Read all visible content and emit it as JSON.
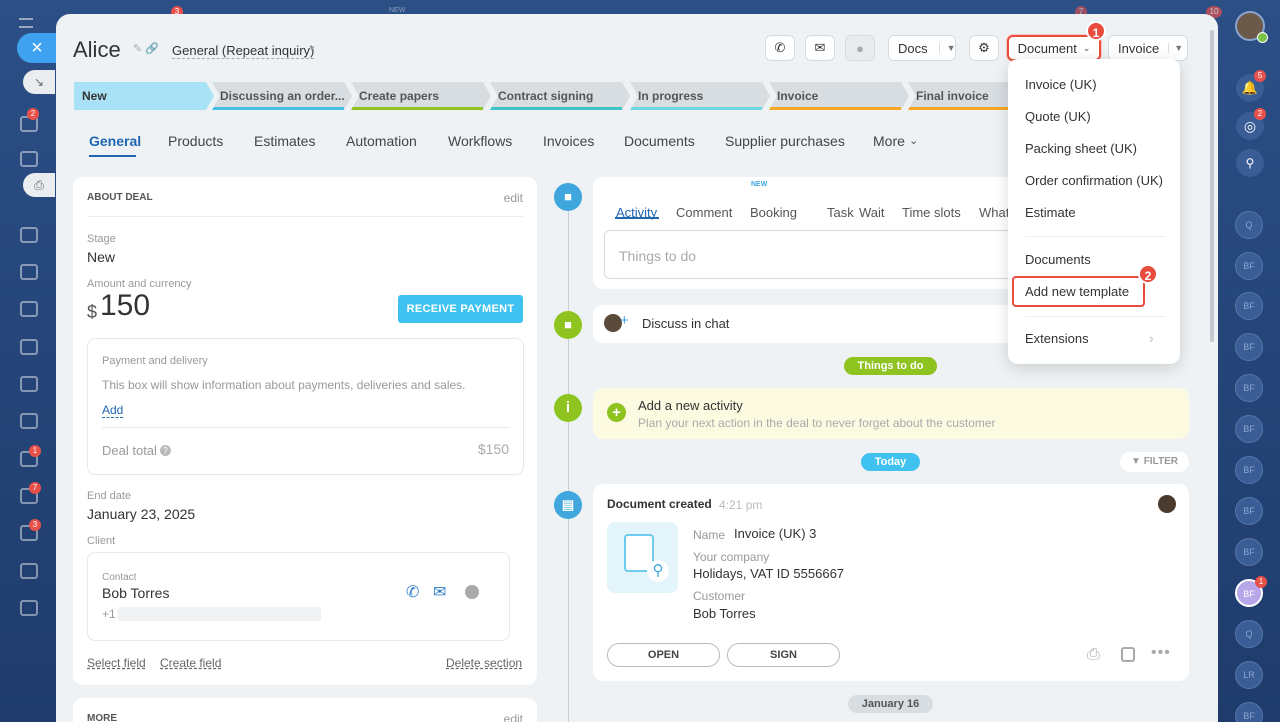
{
  "deal": {
    "title": "Alice",
    "category": "General (Repeat inquiry)"
  },
  "header": {
    "docs_label": "Docs",
    "document_label": "Document",
    "invoice_label": "Invoice",
    "marker_1": "1",
    "marker_2": "2"
  },
  "stages": [
    "New",
    "Discussing an order...",
    "Create papers",
    "Contract signing",
    "In progress",
    "Invoice",
    "Final invoice"
  ],
  "tabs": [
    "General",
    "Products",
    "Estimates",
    "Automation",
    "Workflows",
    "Invoices",
    "Documents",
    "Supplier purchases",
    "More"
  ],
  "about": {
    "heading": "ABOUT DEAL",
    "edit": "edit",
    "stage_label": "Stage",
    "stage_value": "New",
    "amount_label": "Amount and currency",
    "currency": "$",
    "amount": "150",
    "receive_payment": "RECEIVE PAYMENT",
    "payment_title": "Payment and delivery",
    "payment_text": "This box will show information about payments, deliveries and sales.",
    "add": "Add",
    "deal_total_label": "Deal total",
    "deal_total_value": "$150",
    "end_date_label": "End date",
    "end_date_value": "January 23, 2025",
    "client_label": "Client",
    "contact_label": "Contact",
    "contact_name": "Bob Torres",
    "contact_phone": "+1",
    "select_field": "Select field",
    "create_field": "Create field",
    "delete_section": "Delete section"
  },
  "more_section": {
    "heading": "MORE",
    "edit": "edit"
  },
  "activity": {
    "tabs": [
      "Activity",
      "Comment",
      "Booking",
      "Task",
      "Wait",
      "Time slots",
      "What"
    ],
    "booking_badge": "NEW",
    "placeholder": "Things to do",
    "discuss": "Discuss in chat",
    "things_to_do_pill": "Things to do",
    "add_title": "Add a new activity",
    "add_sub": "Plan your next action in the deal to never forget about the customer",
    "today_pill": "Today",
    "filter": "FILTER",
    "date_pill": "January 16"
  },
  "document_event": {
    "title": "Document created",
    "time": "4:21 pm",
    "name_label": "Name",
    "name_value": "Invoice (UK) 3",
    "company_label": "Your company",
    "company_value": "Holidays, VAT ID 5556667",
    "customer_label": "Customer",
    "customer_value": "Bob Torres",
    "open": "OPEN",
    "sign": "SIGN"
  },
  "document_menu": {
    "items": [
      "Invoice (UK)",
      "Quote (UK)",
      "Packing sheet (UK)",
      "Order confirmation (UK)",
      "Estimate"
    ],
    "documents": "Documents",
    "add_template": "Add new template",
    "extensions": "Extensions"
  },
  "right_sidebar": {
    "avatars": [
      "Q",
      "BF",
      "BF",
      "BF",
      "BF",
      "BF",
      "BF",
      "BF",
      "BF",
      "BF",
      "Q",
      "LR",
      "BF"
    ],
    "badges": [
      "5",
      "2",
      "1"
    ]
  },
  "background": {
    "top_new": "NEW",
    "badges": [
      "3",
      "7",
      "10"
    ],
    "left_badges": [
      "2",
      "1",
      "7",
      "3"
    ]
  },
  "colors": {
    "accent": "#2066b0",
    "cyan": "#3fc2f0",
    "green": "#8fc31f",
    "highlight": "#e94b3c"
  }
}
